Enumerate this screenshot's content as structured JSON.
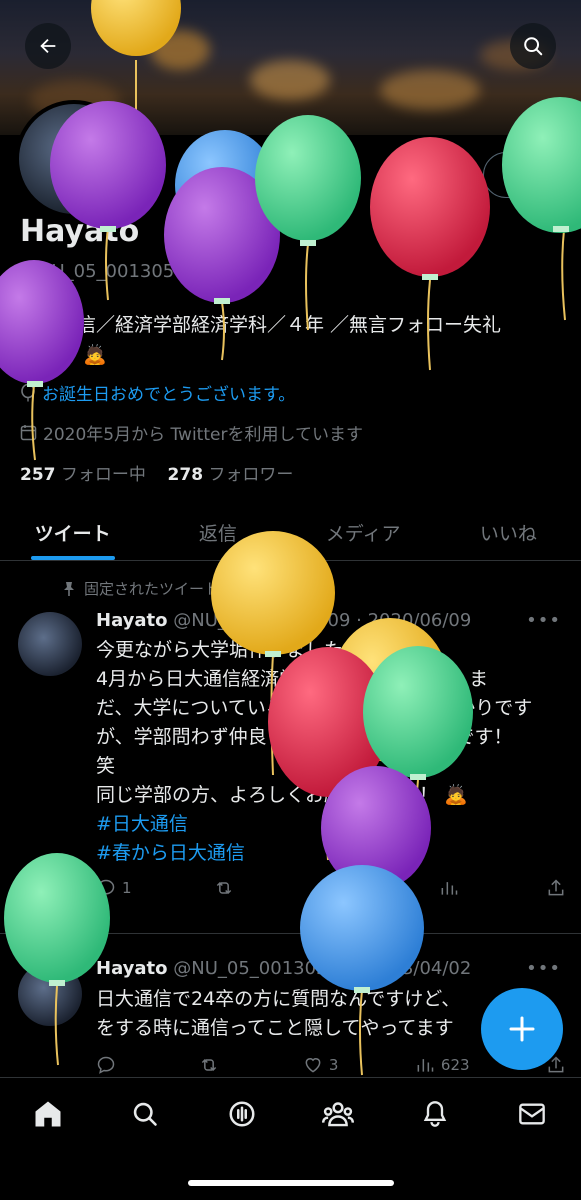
{
  "header": {
    "back_icon": "arrow-left-icon",
    "search_icon": "search-icon"
  },
  "profile": {
    "edit_label": "編集",
    "name": "Hayato",
    "handle": "@NU_05_00130509",
    "bio_line1": "日大通信／経済学部経済学科／４年 ／無言フォロー失礼",
    "bio_line2": "します 🙇",
    "birthday": "お誕生日おめでとうございます。",
    "joined": "2020年5月から Twitterを利用しています",
    "following_count": "257",
    "following_label": "フォロー中",
    "followers_count": "278",
    "followers_label": "フォロワー"
  },
  "tabs": [
    {
      "label": "ツイート",
      "active": true
    },
    {
      "label": "返信",
      "active": false
    },
    {
      "label": "メディア",
      "active": false
    },
    {
      "label": "いいね",
      "active": false
    }
  ],
  "tweets": [
    {
      "pinned_label": "固定されたツイート",
      "name": "Hayato",
      "handle": "@NU_05_00130509",
      "date": "2020/06/09",
      "lines": [
        "今更ながら大学垢作りました！",
        "4月から日大通信経済学部に入学しました！ま",
        "だ、大学についていろいろ分からない事ばかりです",
        "が、学部問わず仲良くして下さると嬉しいです！",
        "笑",
        "同じ学部の方、よろしくお願いします！ 🙇"
      ],
      "hashtags": [
        "#日大通信",
        "#春から日大通信"
      ],
      "replies": "1",
      "retweets": "",
      "likes": "1",
      "views": ""
    },
    {
      "name": "Hayato",
      "handle": "@NU_05_00130509",
      "date": "2023/04/02",
      "lines": [
        "日大通信で24卒の方に質問なんですけど、",
        "をする時に通信ってこと隠してやってます"
      ],
      "replies": "",
      "retweets": "",
      "likes": "3",
      "views": "623"
    }
  ],
  "fab": {
    "icon": "plus-icon"
  },
  "bottom_nav": [
    "home-icon",
    "search-icon",
    "spaces-icon",
    "communities-icon",
    "notifications-icon",
    "messages-icon"
  ],
  "colors": {
    "accent": "#1d9bf0",
    "background": "#000000",
    "muted": "#71767b"
  }
}
